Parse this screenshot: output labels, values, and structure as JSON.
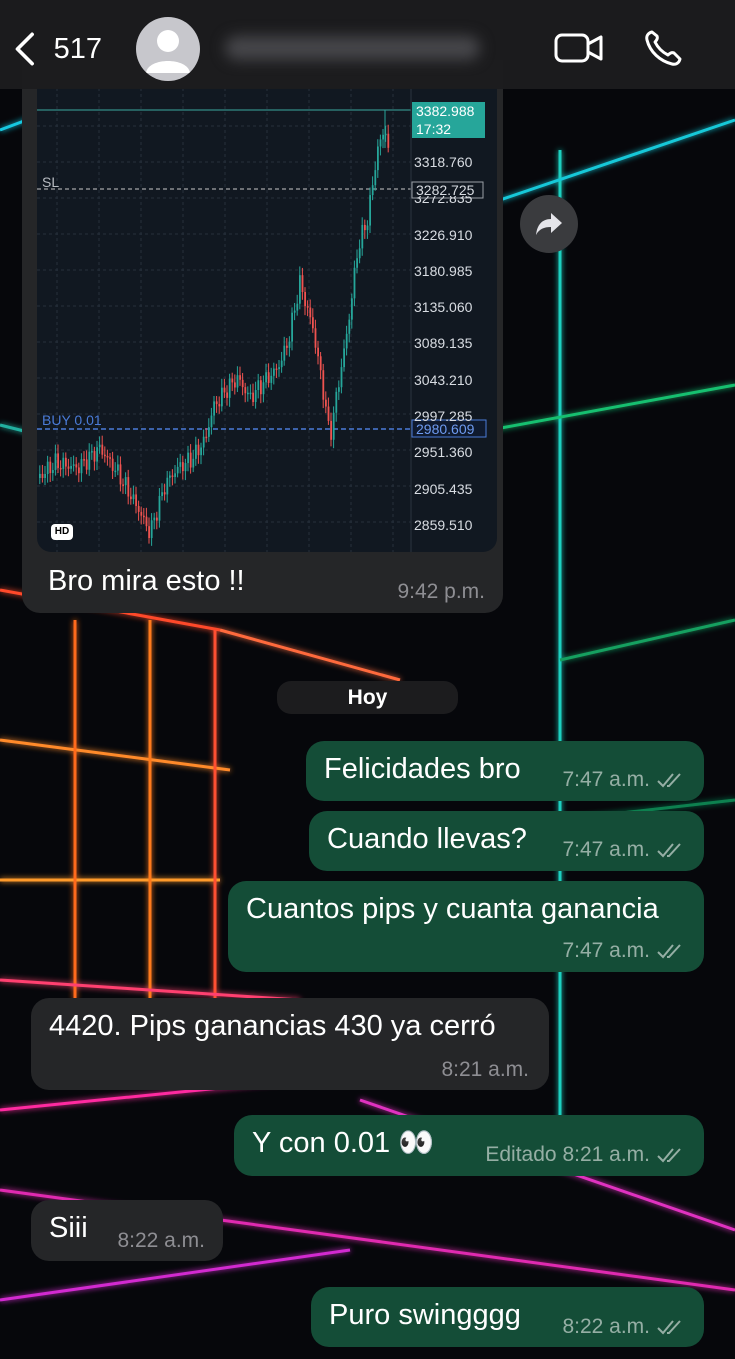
{
  "header": {
    "back_count": "517",
    "contact_name": ""
  },
  "chart_image": {
    "price_labels": [
      "3382.988",
      "17:32",
      "3318.760",
      "3282.725",
      "3272.835",
      "3226.910",
      "3180.985",
      "3135.060",
      "3089.135",
      "3043.210",
      "2997.285",
      "2980.609",
      "2951.360",
      "2905.435",
      "2859.510"
    ],
    "sl_label": "SL",
    "buy_label": "BUY 0.01",
    "hd_label": "HD"
  },
  "messages": [
    {
      "dir": "in",
      "text": "Bro mira esto !!",
      "time": "9:42 p.m."
    },
    {
      "dir": "out",
      "text": "Felicidades bro",
      "time": "7:47 a.m."
    },
    {
      "dir": "out",
      "text": "Cuando llevas?",
      "time": "7:47 a.m."
    },
    {
      "dir": "out",
      "text": "Cuantos pips y cuanta ganancia",
      "time": "7:47 a.m."
    },
    {
      "dir": "in",
      "text": "4420. Pips ganancias 430 ya cerró",
      "time": "8:21 a.m."
    },
    {
      "dir": "out",
      "text": "Y con 0.01 👀",
      "edited": "Editado",
      "time": "8:21 a.m."
    },
    {
      "dir": "in",
      "text": "Siii",
      "time": "8:22 a.m."
    },
    {
      "dir": "out",
      "text": "Puro swingggg",
      "time": "8:22 a.m."
    }
  ],
  "date_separator": "Hoy",
  "colors": {
    "incoming_bubble": "#252628",
    "outgoing_bubble": "#144d37",
    "header_bg": "#1c1c1e",
    "current_price_tag": "#26a69a",
    "buy_line": "#4a7bd8"
  }
}
